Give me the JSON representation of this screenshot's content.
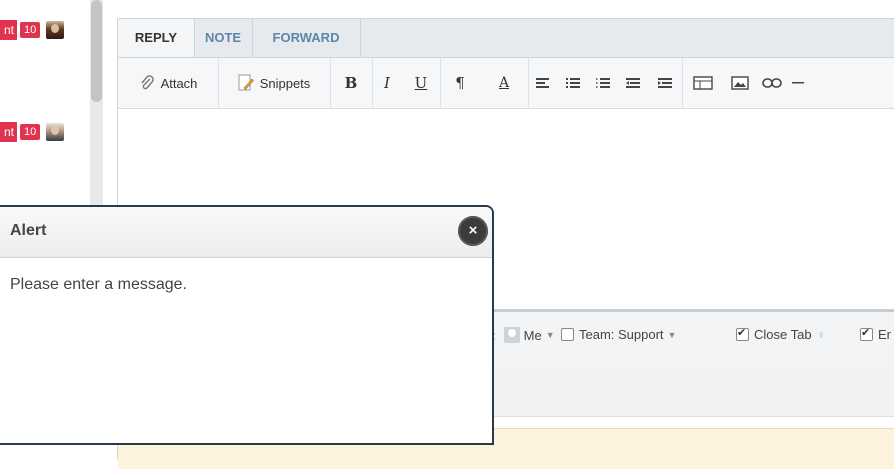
{
  "tickets": [
    {
      "badge_text": "nt",
      "count": "10"
    },
    {
      "badge_text": "nt",
      "count": "10"
    }
  ],
  "editor": {
    "tabs": [
      {
        "label": "REPLY",
        "active": true
      },
      {
        "label": "NOTE",
        "active": false
      },
      {
        "label": "FORWARD",
        "active": false
      }
    ],
    "toolbar": {
      "attach_label": "Attach",
      "snippets_label": "Snippets",
      "bold_glyph": "B",
      "italic_glyph": "I",
      "underline_glyph": "U",
      "paragraph_glyph": "¶",
      "font_color_glyph": "A"
    },
    "options": {
      "assignee_prefix": ":",
      "assignee": "Me",
      "team_label": "Team: Support",
      "team_checked": false,
      "close_tab_label": "Close Tab",
      "close_tab_checked": true,
      "last_label": "Er",
      "last_checked": true
    }
  },
  "alert": {
    "title": "Alert",
    "close_glyph": "×",
    "message": "Please enter a message."
  },
  "colors": {
    "badge": "#e0334f",
    "tab_link": "#5f86a6",
    "alert_border": "#2a3a48"
  }
}
